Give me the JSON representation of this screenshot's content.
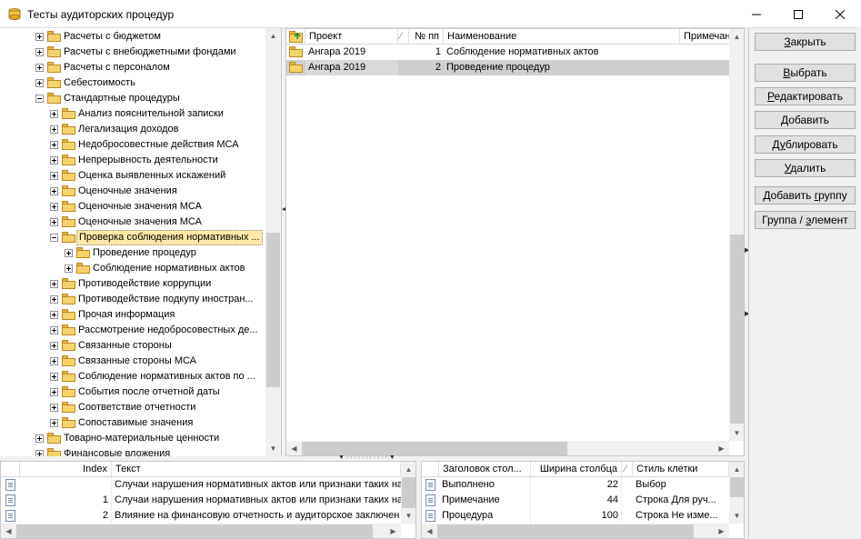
{
  "window": {
    "title": "Тесты аудиторских процедур",
    "minimize_glyph": "—",
    "maximize_glyph": "☐",
    "close_glyph": "✕"
  },
  "tree": {
    "items": [
      {
        "label": "Расчеты с бюджетом",
        "level": 0,
        "expander": "plus"
      },
      {
        "label": "Расчеты с внебюджетными фондами",
        "level": 0,
        "expander": "plus"
      },
      {
        "label": "Расчеты с персоналом",
        "level": 0,
        "expander": "plus"
      },
      {
        "label": "Себестоимость",
        "level": 0,
        "expander": "plus"
      },
      {
        "label": "Стандартные процедуры",
        "level": 0,
        "expander": "minus"
      },
      {
        "label": "Анализ пояснительной записки",
        "level": 1,
        "expander": "plus"
      },
      {
        "label": "Легализация доходов",
        "level": 1,
        "expander": "plus"
      },
      {
        "label": "Недобросовестные действия МСА",
        "level": 1,
        "expander": "plus"
      },
      {
        "label": "Непрерывность деятельности",
        "level": 1,
        "expander": "plus"
      },
      {
        "label": "Оценка выявленных искажений",
        "level": 1,
        "expander": "plus"
      },
      {
        "label": "Оценочные значения",
        "level": 1,
        "expander": "plus"
      },
      {
        "label": "Оценочные значения МСА",
        "level": 1,
        "expander": "plus"
      },
      {
        "label": "Оценочные значения МСА",
        "level": 1,
        "expander": "plus"
      },
      {
        "label": "Проверка соблюдения нормативных ...",
        "level": 1,
        "expander": "minus",
        "selected": true
      },
      {
        "label": "Проведение процедур",
        "level": 2,
        "expander": "plus"
      },
      {
        "label": "Соблюдение нормативных актов",
        "level": 2,
        "expander": "plus"
      },
      {
        "label": "Противодействие коррупции",
        "level": 1,
        "expander": "plus"
      },
      {
        "label": "Противодействие подкупу иностран...",
        "level": 1,
        "expander": "plus"
      },
      {
        "label": "Прочая информация",
        "level": 1,
        "expander": "plus"
      },
      {
        "label": "Рассмотрение недобросовестных де...",
        "level": 1,
        "expander": "plus"
      },
      {
        "label": "Связанные стороны",
        "level": 1,
        "expander": "plus"
      },
      {
        "label": "Связанные стороны МСА",
        "level": 1,
        "expander": "plus"
      },
      {
        "label": "Соблюдение нормативных актов по ...",
        "level": 1,
        "expander": "plus"
      },
      {
        "label": "События после отчетной даты",
        "level": 1,
        "expander": "plus"
      },
      {
        "label": "Соответствие отчетности",
        "level": 1,
        "expander": "plus"
      },
      {
        "label": "Сопоставимые значения",
        "level": 1,
        "expander": "plus"
      },
      {
        "label": "Товарно-материальные ценности",
        "level": 0,
        "expander": "plus"
      },
      {
        "label": "Финансовые вложения",
        "level": 0,
        "expander": "plus"
      }
    ]
  },
  "top_grid": {
    "columns": [
      "Проект",
      "№ пп",
      "Наименование",
      "Примечани"
    ],
    "rows": [
      {
        "project": "Ангара 2019",
        "num": "1",
        "name": "Соблюдение нормативных актов",
        "note": ""
      },
      {
        "project": "Ангара 2019",
        "num": "2",
        "name": "Проведение процедур",
        "note": ""
      }
    ]
  },
  "bottom_left_grid": {
    "columns": [
      "Index",
      "Текст"
    ],
    "rows": [
      {
        "index": "",
        "text": "Случаи нарушения нормативных актов или признаки таких на"
      },
      {
        "index": "1",
        "text": "Случаи нарушения нормативных актов или признаки таких на"
      },
      {
        "index": "2",
        "text": "Влияние на финансовую отчетность и аудиторское заключен"
      }
    ]
  },
  "bottom_right_grid": {
    "columns": [
      "Заголовок стол...",
      "Ширина столбца",
      "Стиль клетки"
    ],
    "rows": [
      {
        "caption": "Выполнено",
        "width": "22",
        "style": "Выбор"
      },
      {
        "caption": "Примечание",
        "width": "44",
        "style": "Строка Для руч..."
      },
      {
        "caption": "Процедура",
        "width": "100",
        "style": "Строка Не изме..."
      }
    ]
  },
  "buttons": {
    "close": {
      "pre": "",
      "u": "З",
      "post": "акрыть"
    },
    "select": {
      "pre": "",
      "u": "В",
      "post": "ыбрать"
    },
    "edit": {
      "pre": "",
      "u": "Р",
      "post": "едактировать"
    },
    "add": {
      "pre": "",
      "u": "Д",
      "post": "обавить"
    },
    "duplicate": {
      "pre": "Д",
      "u": "у",
      "post": "блировать"
    },
    "delete": {
      "pre": "",
      "u": "У",
      "post": "далить"
    },
    "add_group": {
      "pre": "Добавить ",
      "u": "г",
      "post": "руппу"
    },
    "group_element": {
      "pre": "Группа / ",
      "u": "э",
      "post": "лемент"
    }
  },
  "colors": {
    "selection": "#ffe9a8",
    "row_selected": "#cfcfcf",
    "folder": "#f5d36b"
  }
}
